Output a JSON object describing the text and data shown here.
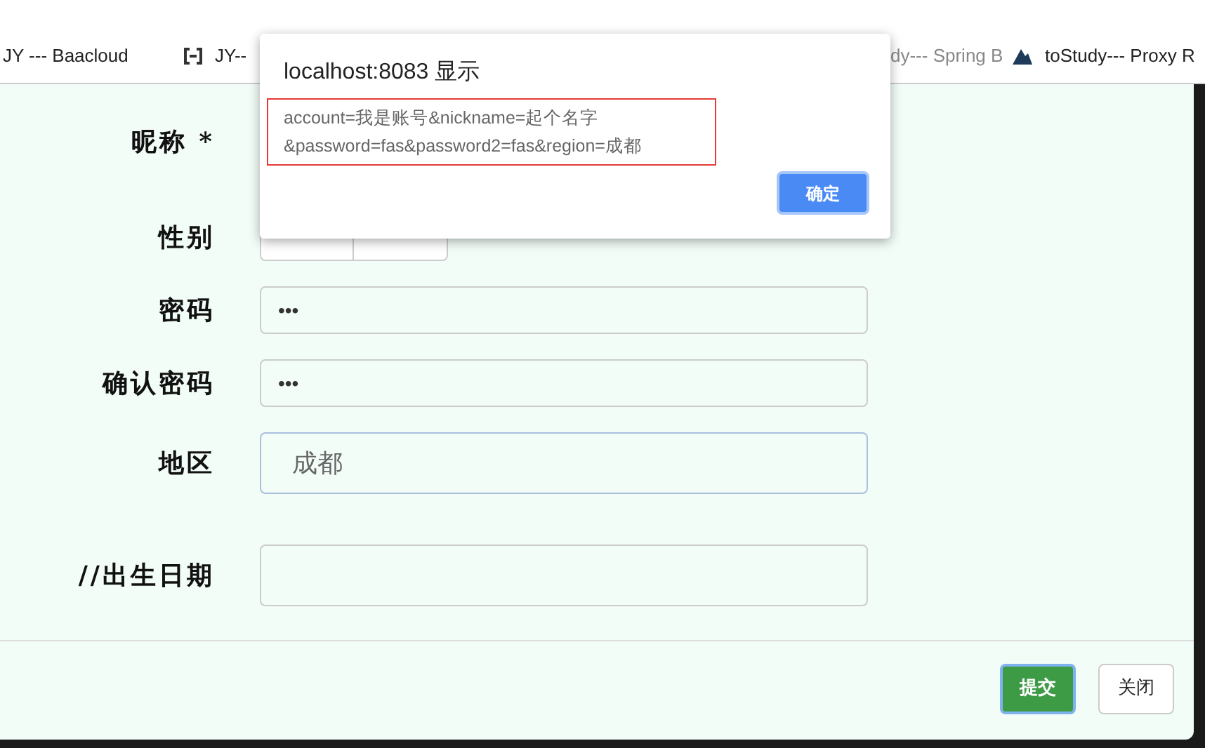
{
  "bookmarks_bar": [
    {
      "label": "JY --- Baacloud",
      "faded": false
    },
    {
      "label": "JY--",
      "faded": false
    },
    {
      "label": "dy--- Spring B",
      "faded": true
    },
    {
      "label": "toStudy--- Proxy R",
      "faded": false
    }
  ],
  "form": {
    "rows": [
      {
        "kind": "text",
        "label": "昵称 *"
      },
      {
        "kind": "toggle",
        "label": "性别"
      },
      {
        "kind": "password",
        "label": "密码",
        "value": "•••"
      },
      {
        "kind": "password",
        "label": "确认密码",
        "value": "•••"
      },
      {
        "kind": "select",
        "label": "地区",
        "value": "成都"
      },
      {
        "kind": "date",
        "label": "//出生日期"
      }
    ],
    "buttons": [
      {
        "label": "提交",
        "primary": true
      },
      {
        "label": "关闭",
        "primary": false
      }
    ]
  },
  "alert": {
    "title": "localhost:8083 显示",
    "message": [
      "account=我是账号&nickname=起个名字",
      "&password=fas&password2=fas&region=成都"
    ],
    "button": "确定"
  }
}
